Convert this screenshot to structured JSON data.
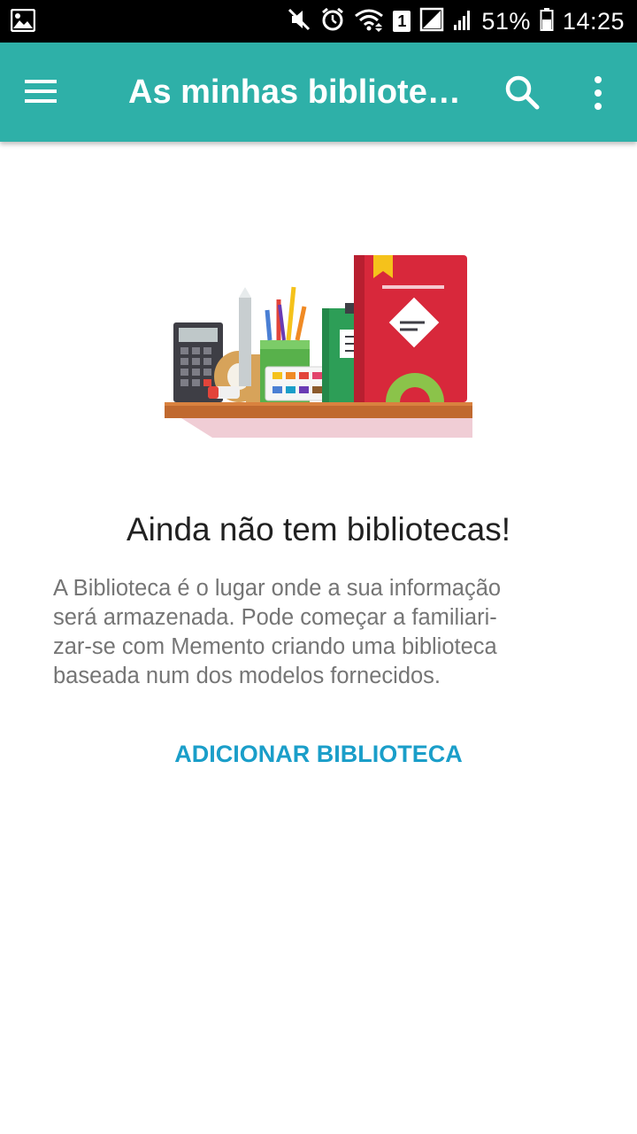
{
  "status_bar": {
    "battery": "51%",
    "time": "14:25",
    "sim_slot": "1",
    "icons": [
      "gallery-notification-icon",
      "mute-icon",
      "alarm-icon",
      "wifi-icon",
      "sim-icon",
      "no-signal-icon",
      "signal-icon",
      "battery-icon"
    ]
  },
  "app_bar": {
    "title": "As minhas bibliotecas",
    "background_color": "#2eb0a8",
    "icons": [
      "menu-icon",
      "search-icon",
      "more-vert-icon"
    ]
  },
  "empty_state": {
    "heading": "Ainda não tem bibliotecas!",
    "description": "A Biblioteca é o lugar onde a sua informação\nserá armazenada. Pode começar a familiari-\nzar-se com Memento criando uma biblioteca\nbaseada num dos modelos fornecidos.",
    "action_label": "ADICIONAR BIBLIOTECA",
    "action_color": "#1a9ec9"
  }
}
